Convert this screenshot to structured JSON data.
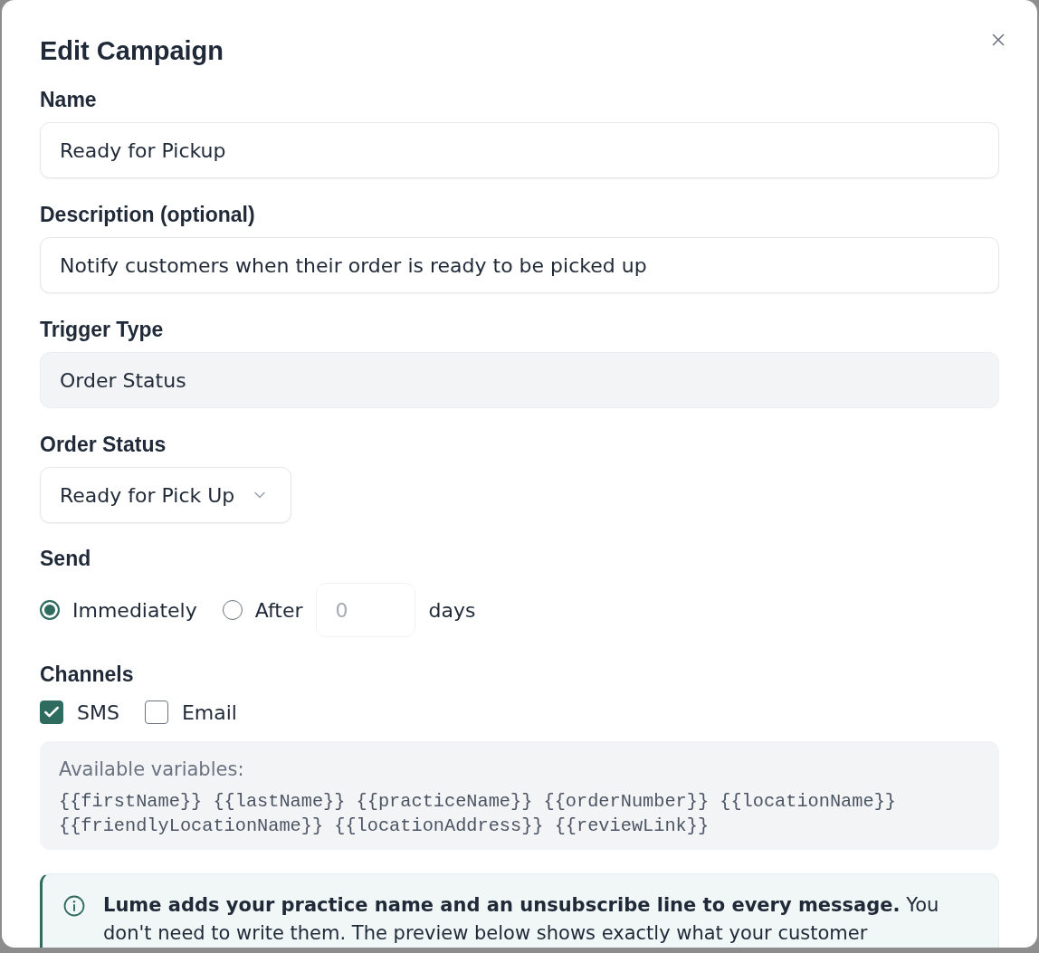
{
  "dialog": {
    "title": "Edit Campaign"
  },
  "fields": [
    {
      "kind": "text",
      "label": "Name",
      "value": "Ready for Pickup"
    },
    {
      "kind": "text",
      "label": "Description (optional)",
      "value": "Notify customers when their order is ready to be picked up"
    },
    {
      "kind": "readonly",
      "label": "Trigger Type",
      "value": "Order Status"
    },
    {
      "kind": "select",
      "label": "Order Status",
      "value": "Ready for Pick Up"
    }
  ],
  "send": {
    "label": "Send",
    "options": [
      {
        "label": "Immediately",
        "selected": true
      },
      {
        "label": "After",
        "selected": false
      }
    ],
    "days_field": {
      "placeholder": "0",
      "disabled": true
    },
    "unit": "days"
  },
  "channels": {
    "label": "Channels",
    "options": [
      {
        "label": "SMS",
        "checked": true
      },
      {
        "label": "Email",
        "checked": false
      }
    ]
  },
  "variables": {
    "title": "Available variables:",
    "list": "{{firstName}} {{lastName}} {{practiceName}} {{orderNumber}} {{locationName}} {{friendlyLocationName}} {{locationAddress}} {{reviewLink}}"
  },
  "notice": {
    "text": "**Lume adds your practice name and an unsubscribe line to every message.** You don't need to write them. The preview below shows exactly what your customer"
  }
}
